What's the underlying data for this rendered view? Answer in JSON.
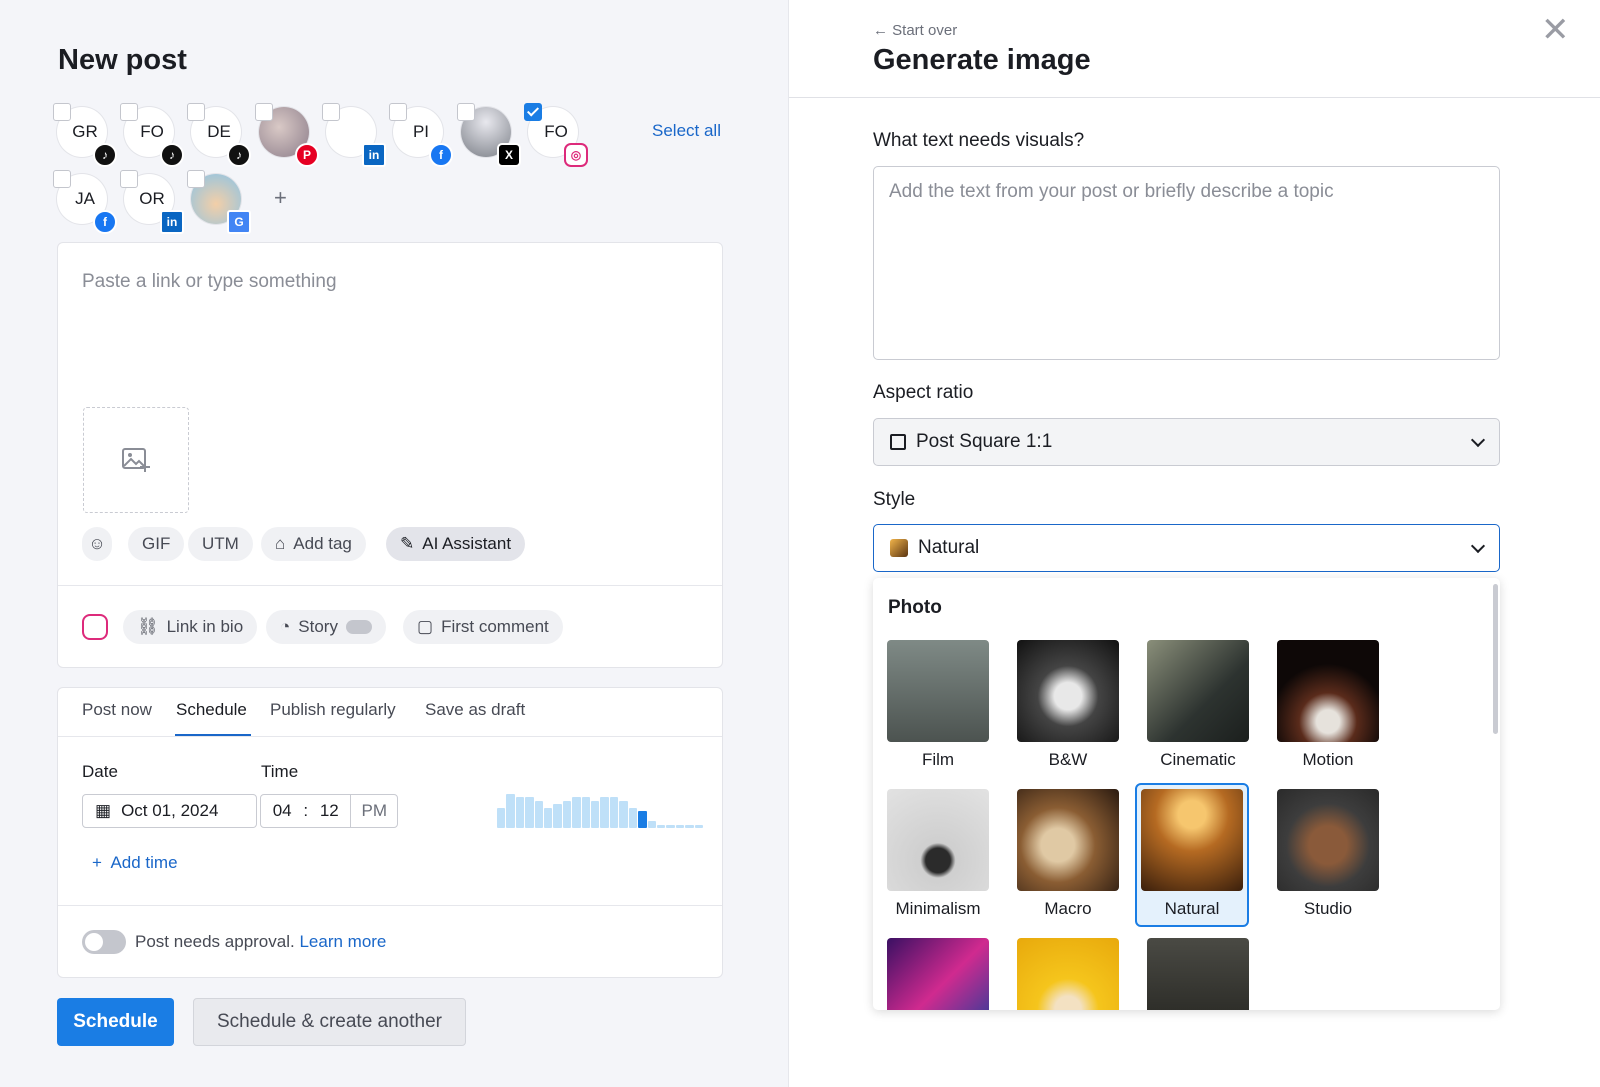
{
  "left": {
    "title": "New post",
    "select_all": "Select all",
    "accounts": [
      {
        "label": "GR",
        "network": "TikTok",
        "badge": "♪",
        "checked": false
      },
      {
        "label": "FO",
        "network": "TikTok",
        "badge": "♪",
        "checked": false
      },
      {
        "label": "DE",
        "network": "TikTok",
        "badge": "♪",
        "checked": false
      },
      {
        "label": "",
        "network": "Pinterest",
        "badge": "P",
        "checked": false
      },
      {
        "label": "",
        "network": "LinkedIn",
        "badge": "in",
        "checked": false
      },
      {
        "label": "PI",
        "network": "Facebook",
        "badge": "f",
        "checked": false
      },
      {
        "label": "",
        "network": "X",
        "badge": "X",
        "checked": false
      },
      {
        "label": "FO",
        "network": "Instagram",
        "badge": "◎",
        "checked": true
      },
      {
        "label": "JA",
        "network": "Facebook",
        "badge": "f",
        "checked": false
      },
      {
        "label": "OR",
        "network": "LinkedIn",
        "badge": "in",
        "checked": false
      },
      {
        "label": "",
        "network": "Google Business",
        "badge": "G",
        "checked": false
      }
    ],
    "add_account": "+",
    "composer": {
      "placeholder": "Paste a link or type something",
      "tools": {
        "gif": "GIF",
        "utm": "UTM",
        "add_tag": "Add tag",
        "ai_assistant": "AI Assistant"
      },
      "instagram_options": {
        "link_in_bio": "Link in bio",
        "story": "Story",
        "first_comment": "First comment"
      }
    },
    "schedule": {
      "tabs": [
        "Post now",
        "Schedule",
        "Publish regularly",
        "Save as draft"
      ],
      "active_tab": "Schedule",
      "date_label": "Date",
      "time_label": "Time",
      "date_value": "Oct 01, 2024",
      "hour": "04",
      "minute": "12",
      "time_sep": ":",
      "ampm": "PM",
      "add_time": "Add time",
      "approval_text": "Post needs approval.",
      "learn_more": "Learn more",
      "activity": [
        6,
        10,
        9,
        9,
        8,
        6,
        7,
        8,
        9,
        9,
        8,
        9,
        9,
        8,
        6,
        5,
        2,
        1,
        1,
        1,
        1,
        1
      ],
      "activity_current_index": 15
    },
    "buttons": {
      "schedule": "Schedule",
      "schedule_another": "Schedule & create another"
    }
  },
  "right": {
    "back": "Start over",
    "title": "Generate image",
    "text_label": "What text needs visuals?",
    "text_placeholder": "Add the text from your post or briefly describe a topic",
    "aspect_label": "Aspect ratio",
    "aspect_value": "Post Square 1:1",
    "style_label": "Style",
    "style_value": "Natural",
    "dropdown": {
      "group": "Photo",
      "styles": [
        "Film",
        "B&W",
        "Cinematic",
        "Motion",
        "Minimalism",
        "Macro",
        "Natural",
        "Studio"
      ],
      "selected": "Natural"
    }
  },
  "colors": {
    "primary": "#1a7de4",
    "link": "#1a67c9",
    "selected_bg": "#e4f1fc"
  }
}
